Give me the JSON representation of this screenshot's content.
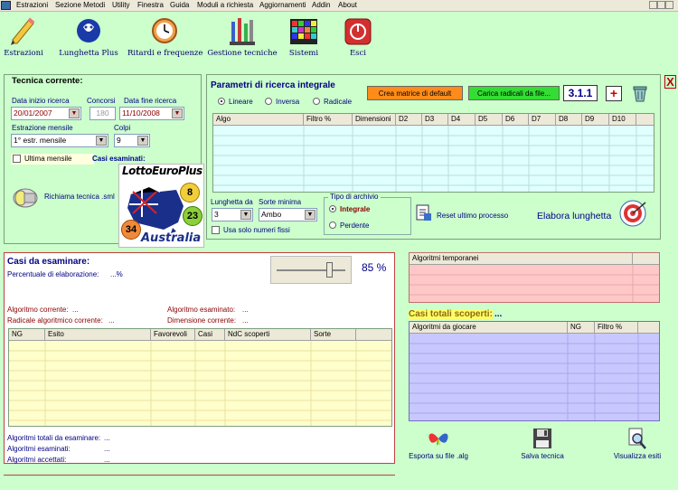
{
  "menu": [
    "Estrazioni",
    "Sezione Metodi",
    "Utility",
    "Finestra",
    "Guida",
    "Moduli a richiesta",
    "Aggiornamenti",
    "Addin",
    "About"
  ],
  "toolbar": [
    {
      "label": "Estrazioni",
      "icon": "pencil-icon"
    },
    {
      "label": "Lunghetta Plus",
      "icon": "lottery-logo-icon"
    },
    {
      "label": "Ritardi e frequenze",
      "icon": "clock-icon"
    },
    {
      "label": "Gestione tecniche",
      "icon": "tools-icon"
    },
    {
      "label": "Sistemi",
      "icon": "grid-icon"
    },
    {
      "label": "Esci",
      "icon": "exit-icon"
    }
  ],
  "close_label": "X",
  "tecnica": {
    "title": "Tecnica corrente:",
    "data_inizio_label": "Data inizio ricerca",
    "data_inizio_value": "20/01/2007",
    "concorsi_label": "Concorsi",
    "concorsi_value": "180",
    "data_fine_label": "Data fine ricerca",
    "data_fine_value": "11/10/2008",
    "estrazione_label": "Estrazione mensile",
    "estrazione_value": "1° estr. mensile",
    "colpi_label": "Colpi",
    "colpi_value": "9",
    "ultima_label": "Ultima mensile",
    "casi_label": "Casi esaminati:",
    "richiama_label": "Richiama tecnica .sml",
    "logo_top": "LottoEuroPlus",
    "logo_bottom": "Australia",
    "ball1": "8",
    "ball2": "23",
    "ball3": "34"
  },
  "parametri": {
    "title": "Parametri di ricerca integrale",
    "radio1": "Lineare",
    "radio2": "Inversa",
    "radio3": "Radicale",
    "btn_default": "Crea matrice di default",
    "btn_radicali": "Carica radicali da file...",
    "version": "3.1.1",
    "plus": "+",
    "columns": [
      "Algo",
      "Filtro %",
      "Dimensioni",
      "D2",
      "D3",
      "D4",
      "D5",
      "D6",
      "D7",
      "D8",
      "D9",
      "D10"
    ],
    "lunghetta_label": "Lunghetta da",
    "lunghetta_value": "3",
    "sorte_label": "Sorte minima",
    "sorte_value": "Ambo",
    "fissi_label": "Usa solo numeri fissi",
    "archivio_label": "Tipo di archivio",
    "integrale": "Integrale",
    "perdente": "Perdente",
    "reset_label": "Reset ultimo processo",
    "elabora_label": "Elabora lunghetta"
  },
  "casi": {
    "title": "Casi da esaminare:",
    "perc_label": "Percentuale di elaborazione:",
    "perc_value": "...%",
    "progress_pct": "85 %",
    "slider_value": 0.78,
    "algo_corrente": "Algoritmo corrente:",
    "algo_corrente_v": "...",
    "algo_esaminato": "Algoritmo esaminato:",
    "algo_esaminato_v": "...",
    "radicale": "Radicale algoritmico corrente:",
    "radicale_v": "...",
    "dimensione": "Dimensione corrente:",
    "dimensione_v": "...",
    "columns": [
      "NG",
      "Esito",
      "Favorevoli",
      "Casi",
      "NdC scoperti",
      "Sorte"
    ],
    "tot_label": "Algoritmi totali da esaminare:",
    "tot_v": "...",
    "esam_label": "Algoritmi esaminati:",
    "esam_v": "...",
    "acc_label": "Algoritmi accettati:",
    "acc_v": "..."
  },
  "right": {
    "temp_col": "Algoritmi temporanei",
    "casi_totali": "Casi totali scoperti:",
    "casi_totali_v": "...",
    "giocare_cols": [
      "Algoritmi da giocare",
      "NG",
      "Filtro %"
    ],
    "esporta": "Esporta su file .alg",
    "salva": "Salva tecnica",
    "visualizza": "Visualizza esiti"
  }
}
